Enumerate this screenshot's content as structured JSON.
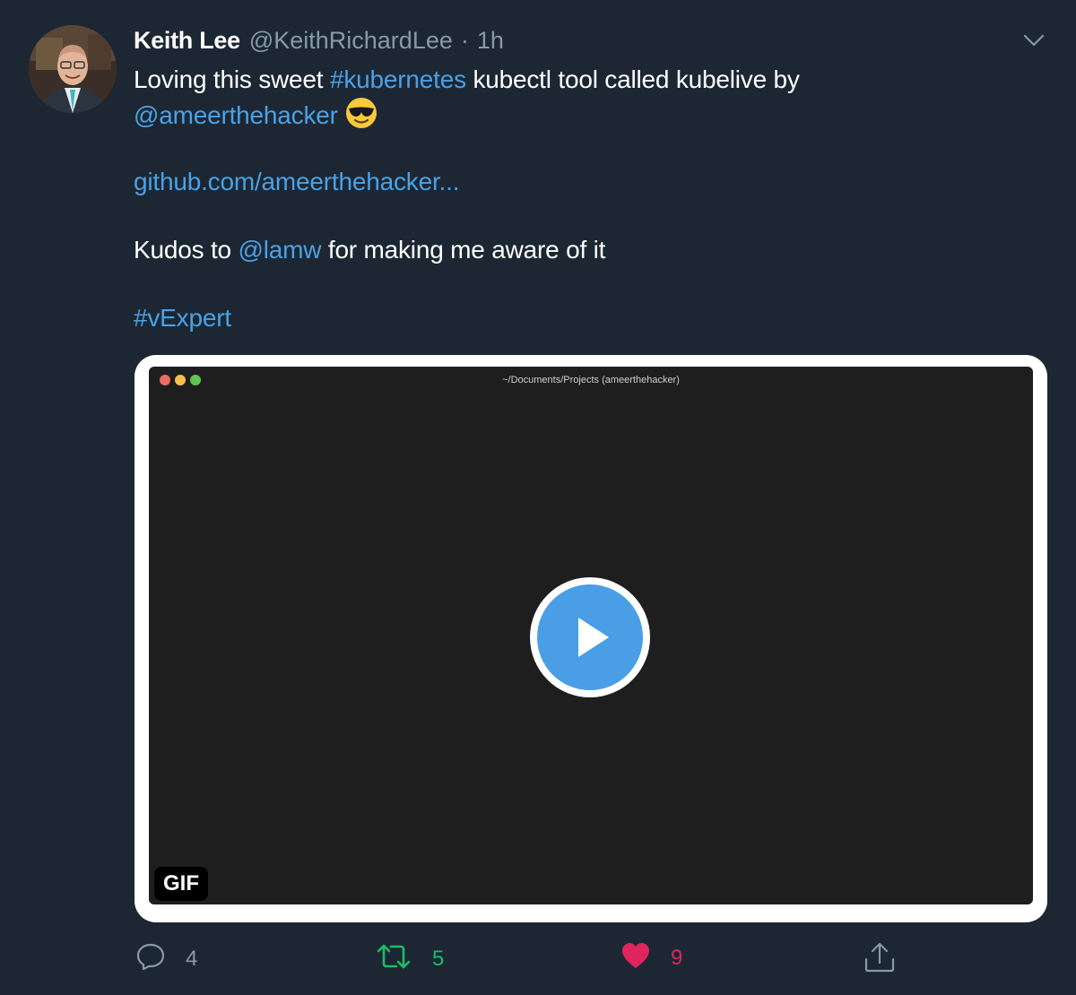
{
  "author": {
    "name": "Keith Lee",
    "handle": "@KeithRichardLee",
    "separator": "·",
    "time": "1h"
  },
  "tweet": {
    "line1": {
      "prefix": "Loving this sweet ",
      "hashtag": "#kubernetes",
      "suffix": " kubectl tool called kubelive by"
    },
    "line2": {
      "mention": "@ameerthehacker",
      "emoji": "smiling-face-with-sunglasses"
    },
    "link": "github.com/ameerthehacker...",
    "line4": {
      "prefix": "Kudos to ",
      "mention": "@lamw",
      "suffix": " for making me aware of it"
    },
    "hashtag": "#vExpert"
  },
  "media": {
    "window_title": "~/Documents/Projects (ameerthehacker)",
    "badge": "GIF",
    "play_icon": "play-icon"
  },
  "actions": {
    "reply_count": "4",
    "retweet_count": "5",
    "like_count": "9"
  },
  "colors": {
    "background": "#1c2733",
    "link": "#4aa1e6",
    "secondary_text": "#8899a6",
    "retweet": "#17bf63",
    "like": "#e0245e",
    "play": "#4a9ee6"
  }
}
